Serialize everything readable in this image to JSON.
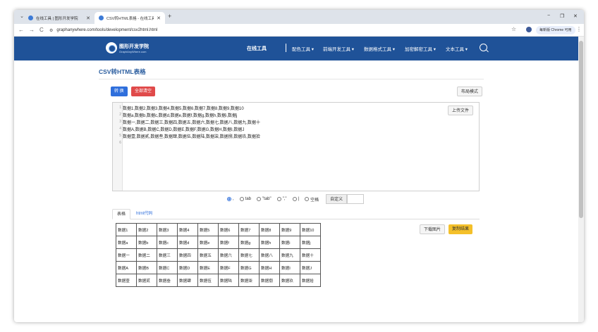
{
  "browser": {
    "tabs": [
      {
        "title": "在线工具 | 图形开发学院",
        "active": false
      },
      {
        "title": "CSV转HTML表格 - 在线工具 | ",
        "active": true
      }
    ],
    "new_tab": "+",
    "url": "graphanywhere.com/tools/development/csv2html.html",
    "profile_label": "每新版 Chrome 可用",
    "window_controls": {
      "minimize": "−",
      "restore": "❐",
      "close": "✕"
    }
  },
  "site": {
    "logo": {
      "name": "图形开发学院",
      "domain": "GraphAnyWhere.com"
    },
    "nav": [
      {
        "label": "在线工具",
        "active": true
      },
      {
        "label": "配色工具 ▾"
      },
      {
        "label": "前端开发工具 ▾"
      },
      {
        "label": "数据格式工具 ▾"
      },
      {
        "label": "加密解密工具 ▾"
      },
      {
        "label": "文本工具 ▾"
      }
    ]
  },
  "page": {
    "title": "CSV转HTML表格",
    "buttons": {
      "convert": "转 换",
      "clear": "全部清空",
      "layout": "布局模式",
      "upload": "上传文件",
      "download_image": "下载图片",
      "copy_result": "复制结果"
    },
    "editor_lines": [
      "数据1,数据2,数据3,数据4,数据5,数据6,数据7,数据8,数据9,数据10",
      "数据a,数据b,数据c,数据d,数据e,数据f,数据g,数据h,数据i,数据j",
      "数据一,数据二,数据三,数据四,数据五,数据六,数据七,数据八,数据九,数据十",
      "数据A,数据B,数据C,数据D,数据E,数据F,数据G,数据H,数据I,数据J",
      "数据壹,数据贰,数据叁,数据肆,数据伍,数据陆,数据柒,数据捌,数据玖,数据拾"
    ],
    "line_numbers": [
      "1",
      "2",
      "3",
      "4",
      "5",
      "6"
    ],
    "delimiters": [
      {
        "label": ",",
        "checked": true
      },
      {
        "label": "tab",
        "checked": false
      },
      {
        "label": "\"tab\"",
        "checked": false
      },
      {
        "label": "\",\"",
        "checked": false
      },
      {
        "label": "|",
        "checked": false
      },
      {
        "label": "空格",
        "checked": false
      }
    ],
    "custom_label": "自定义",
    "view_tabs": [
      "表格",
      "html代码"
    ],
    "table": [
      [
        "数据1",
        "数据2",
        "数据3",
        "数据4",
        "数据5",
        "数据6",
        "数据7",
        "数据8",
        "数据9",
        "数据10"
      ],
      [
        "数据a",
        "数据b",
        "数据c",
        "数据d",
        "数据e",
        "数据f",
        "数据g",
        "数据h",
        "数据i",
        "数据j"
      ],
      [
        "数据一",
        "数据二",
        "数据三",
        "数据四",
        "数据五",
        "数据六",
        "数据七",
        "数据八",
        "数据九",
        "数据十"
      ],
      [
        "数据A",
        "数据B",
        "数据C",
        "数据D",
        "数据E",
        "数据F",
        "数据G",
        "数据H",
        "数据I",
        "数据J"
      ],
      [
        "数据壹",
        "数据贰",
        "数据叁",
        "数据肆",
        "数据伍",
        "数据陆",
        "数据柒",
        "数据捌",
        "数据玖",
        "数据拾"
      ]
    ]
  },
  "colors": {
    "header_bg": "#1f5298",
    "title": "#2a5d9f",
    "primary": "#2f6fdc",
    "danger": "#e04a4a",
    "warning": "#f4c02a"
  }
}
